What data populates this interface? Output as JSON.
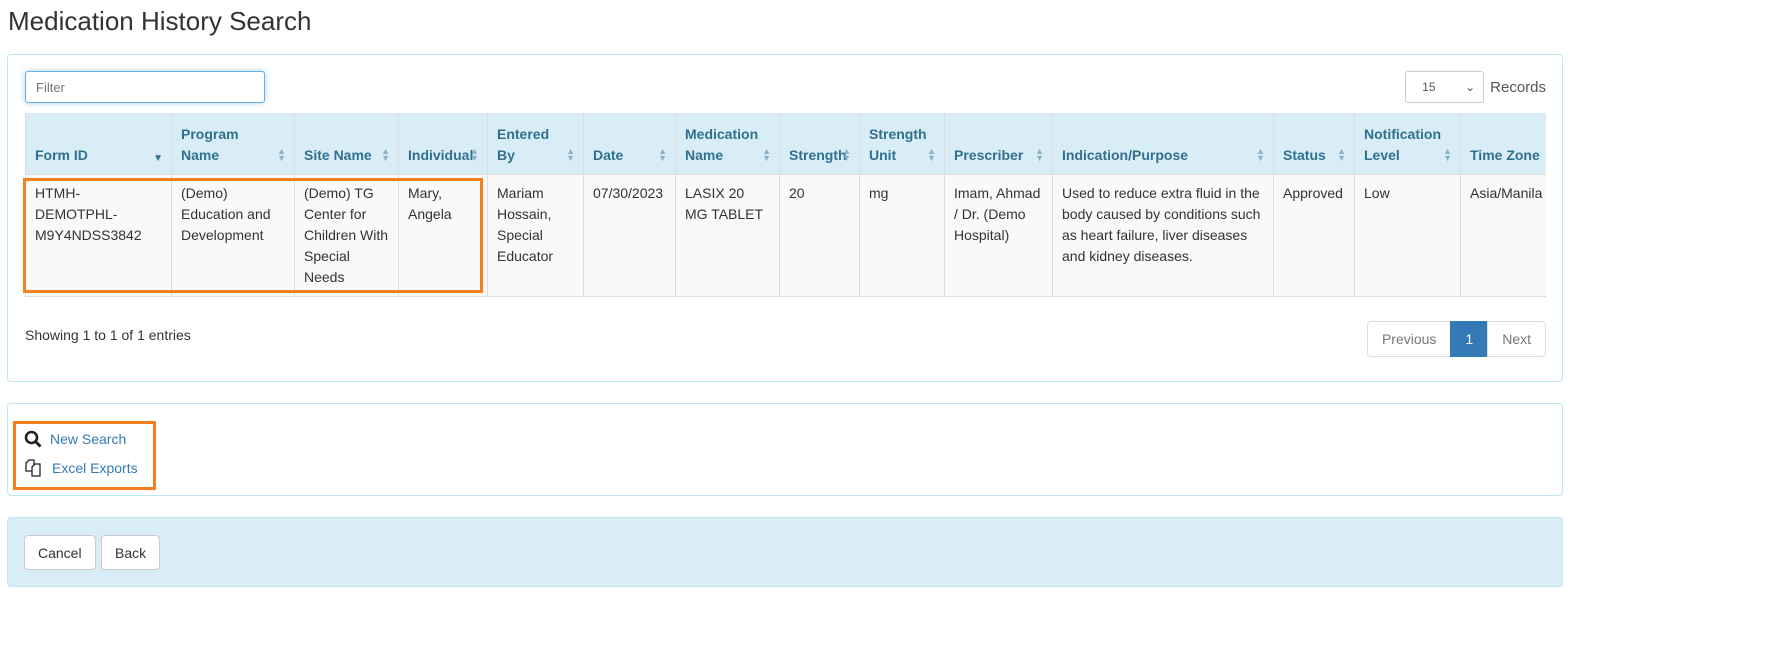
{
  "page_title": "Medication History Search",
  "filter": {
    "placeholder": "Filter"
  },
  "records": {
    "value": "15",
    "label": "Records"
  },
  "table": {
    "columns": [
      "Form ID",
      "Program Name",
      "Site Name",
      "Individual",
      "Entered By",
      "Date",
      "Medication Name",
      "Strength",
      "Strength Unit",
      "Prescriber",
      "Indication/Purpose",
      "Status",
      "Notification Level",
      "Time Zone"
    ],
    "rows": [
      [
        "HTMH-DEMOTPHL-M9Y4NDSS3842",
        "(Demo) Education and Development",
        "(Demo) TG Center for Children With Special Needs",
        "Mary, Angela",
        "Mariam Hossain, Special Educator",
        "07/30/2023",
        "LASIX 20 MG TABLET",
        "20",
        "mg",
        "Imam, Ahmad / Dr. (Demo Hospital)",
        "Used to reduce extra fluid in the body caused by conditions such as heart failure, liver diseases and kidney diseases.",
        "Approved",
        "Low",
        "Asia/Manila"
      ]
    ]
  },
  "info": "Showing 1 to 1 of 1 entries",
  "pager": {
    "previous": "Previous",
    "page": "1",
    "next": "Next"
  },
  "actions": {
    "new_search": "New Search",
    "excel_exports": "Excel Exports"
  },
  "footer": {
    "cancel": "Cancel",
    "back": "Back"
  },
  "colors": {
    "highlight": "#f47f20",
    "header_bg": "#d9edf7",
    "link": "#337ab7"
  }
}
